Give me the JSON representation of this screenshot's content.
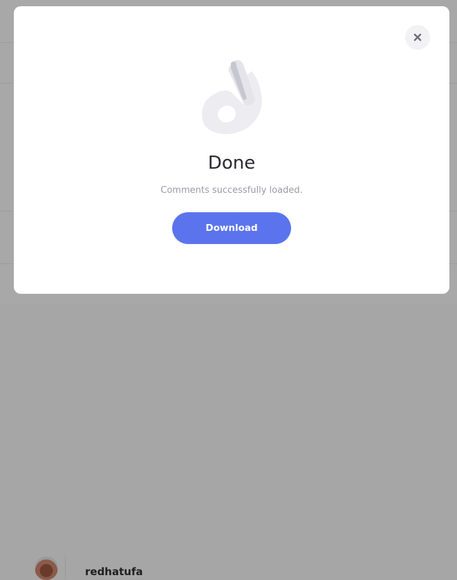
{
  "background": {
    "username": "redhatufa"
  },
  "modal": {
    "title": "Done",
    "message": "Comments successfully loaded.",
    "download_label": "Download",
    "illustration_icon": "ok-hand-icon",
    "close_icon": "close-icon"
  },
  "colors": {
    "accent": "#5b74ee",
    "overlay": "#a8a8a8",
    "icon_fill": "#ececf1"
  }
}
